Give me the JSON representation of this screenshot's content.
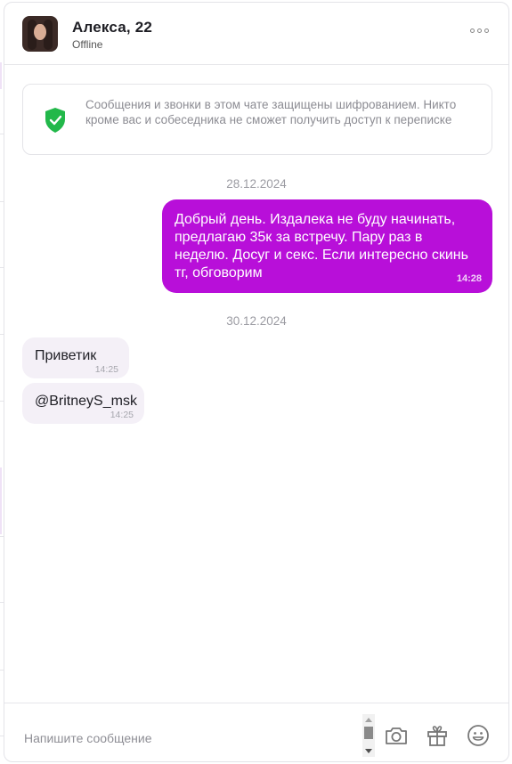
{
  "header": {
    "name": "Алекса, 22",
    "status": "Offline",
    "more_icon": "more-icon"
  },
  "notice": {
    "text": "Сообщения и звонки в этом чате защищены шифрованием. Никто кроме вас и собеседника не сможет получить доступ к переписке",
    "icon": "shield-check-icon",
    "icon_color": "#22b84a"
  },
  "messages": [
    {
      "date": "28.12.2024"
    },
    {
      "direction": "outgoing",
      "text": "Добрый день. Издалека не буду начинать, предлагаю 35к за встречу. Пару раз в неделю. Досуг и секс. Если интересно скинь тг, обговорим",
      "time": "14:28"
    },
    {
      "date": "30.12.2024"
    },
    {
      "direction": "incoming",
      "text": "Приветик",
      "time": "14:25"
    },
    {
      "direction": "incoming",
      "text": "@BritneyS_msk",
      "time": "14:25"
    }
  ],
  "composer": {
    "placeholder": "Напишите сообщение",
    "icons": [
      "camera-icon",
      "gift-icon",
      "emoji-icon"
    ]
  },
  "colors": {
    "accent": "#b80fd9",
    "incoming_bubble": "#f4f0f7",
    "shield": "#22b84a"
  }
}
